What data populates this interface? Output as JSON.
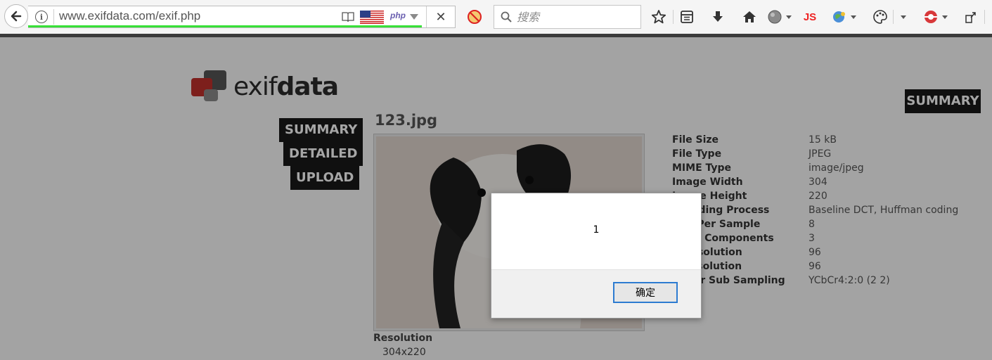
{
  "browser": {
    "url": "www.exifdata.com/exif.php",
    "php_label": "php",
    "search_placeholder": "搜索",
    "js_label": "JS"
  },
  "site": {
    "logo_light": "exif",
    "logo_bold": "data",
    "nav": [
      "SUMMARY",
      "DETAILED",
      "UPLOAD"
    ],
    "right_summary": "SUMMARY",
    "file_name": "123.jpg",
    "resolution_label": "Resolution",
    "resolution_value": "304x220",
    "metadata": [
      {
        "key": "File Size",
        "value": "15 kB"
      },
      {
        "key": "File Type",
        "value": "JPEG"
      },
      {
        "key": "MIME Type",
        "value": "image/jpeg"
      },
      {
        "key": "Image Width",
        "value": "304"
      },
      {
        "key": "Image Height",
        "value": "220"
      },
      {
        "key": "Encoding Process",
        "value": "Baseline DCT, Huffman coding"
      },
      {
        "key": "Bits Per Sample",
        "value": "8"
      },
      {
        "key": "Color Components",
        "value": "3"
      },
      {
        "key": "X Resolution",
        "value": "96"
      },
      {
        "key": "Y Resolution",
        "value": "96"
      },
      {
        "key": "YCbCr Sub Sampling",
        "value": "YCbCr4:2:0 (2 2)"
      }
    ]
  },
  "dialog": {
    "message": "1",
    "ok_label": "确定"
  },
  "colors": {
    "accent": "#2d7bd1",
    "progress": "#38e038",
    "logo_red": "#c0302c"
  }
}
